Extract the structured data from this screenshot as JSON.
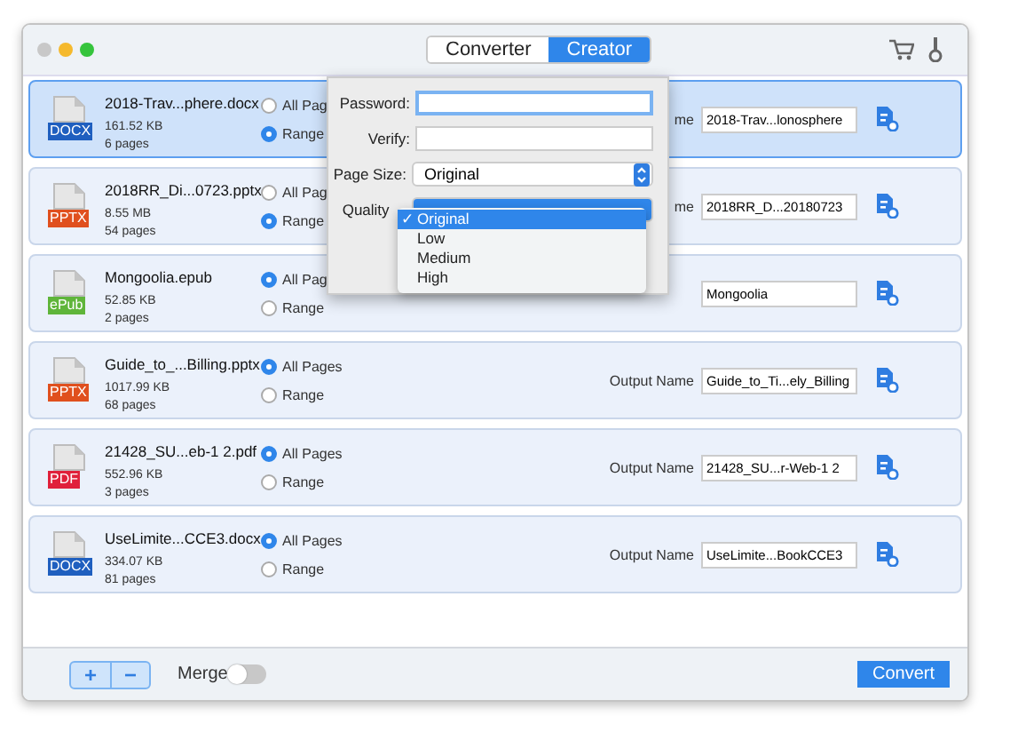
{
  "window": {
    "tabs": [
      {
        "label": "Converter",
        "selected": false
      },
      {
        "label": "Creator",
        "selected": true
      }
    ]
  },
  "files": [
    {
      "name": "2018-Trav...phere.docx",
      "size": "161.52 KB",
      "pages": "6 pages",
      "type": "DOCX",
      "color": "#1f5fbf",
      "selected": true,
      "options": [
        {
          "label": "All Pag",
          "selected": false
        },
        {
          "label": "Range",
          "selected": true
        }
      ],
      "output_label": "me",
      "output_name": "2018-Trav...lonosphere"
    },
    {
      "name": "2018RR_Di...0723.pptx",
      "size": "8.55 MB",
      "pages": "54 pages",
      "type": "PPTX",
      "color": "#e0501e",
      "selected": false,
      "options": [
        {
          "label": "All Pag",
          "selected": false
        },
        {
          "label": "Range",
          "selected": true
        }
      ],
      "output_label": "me",
      "output_name": "2018RR_D...20180723"
    },
    {
      "name": "Mongoolia.epub",
      "size": "52.85 KB",
      "pages": "2 pages",
      "type": "ePub",
      "color": "#5fb53a",
      "selected": false,
      "options": [
        {
          "label": "All Pag",
          "selected": true
        },
        {
          "label": "Range",
          "selected": false
        }
      ],
      "output_name": "Mongoolia"
    },
    {
      "name": "Guide_to_...Billing.pptx",
      "size": "1017.99 KB",
      "pages": "68 pages",
      "type": "PPTX",
      "color": "#e0501e",
      "selected": false,
      "options": [
        {
          "label": "All Pages",
          "selected": true
        },
        {
          "label": "Range",
          "selected": false
        }
      ],
      "output_label": "Output Name",
      "output_name": "Guide_to_Ti...ely_Billing"
    },
    {
      "name": "21428_SU...eb-1 2.pdf",
      "size": "552.96 KB",
      "pages": "3 pages",
      "type": "PDF",
      "color": "#e0203a",
      "selected": false,
      "options": [
        {
          "label": "All Pages",
          "selected": true
        },
        {
          "label": "Range",
          "selected": false
        }
      ],
      "output_label": "Output Name",
      "output_name": "21428_SU...r-Web-1 2"
    },
    {
      "name": "UseLimite...CCE3.docx",
      "size": "334.07 KB",
      "pages": "81 pages",
      "type": "DOCX",
      "color": "#1f5fbf",
      "selected": false,
      "options": [
        {
          "label": "All Pages",
          "selected": true
        },
        {
          "label": "Range",
          "selected": false
        }
      ],
      "output_label": "Output Name",
      "output_name": "UseLimite...BookCCE3"
    }
  ],
  "popover": {
    "fields": [
      {
        "kind": "input",
        "label": "Password:",
        "focused": true
      },
      {
        "kind": "input",
        "label": "Verify:",
        "focused": false
      },
      {
        "kind": "select",
        "label": "Page Size:",
        "value": "Original"
      },
      {
        "kind": "menu",
        "label": "Quality",
        "mark": "✓",
        "options": [
          {
            "label": "Original",
            "selected": true
          },
          {
            "label": "Low",
            "selected": false
          },
          {
            "label": "Medium",
            "selected": false
          },
          {
            "label": "High",
            "selected": false
          }
        ]
      }
    ]
  },
  "bottom": {
    "add": "+",
    "remove": "−",
    "merge": {
      "label": "Merge",
      "on": false
    },
    "convert": "Convert"
  }
}
